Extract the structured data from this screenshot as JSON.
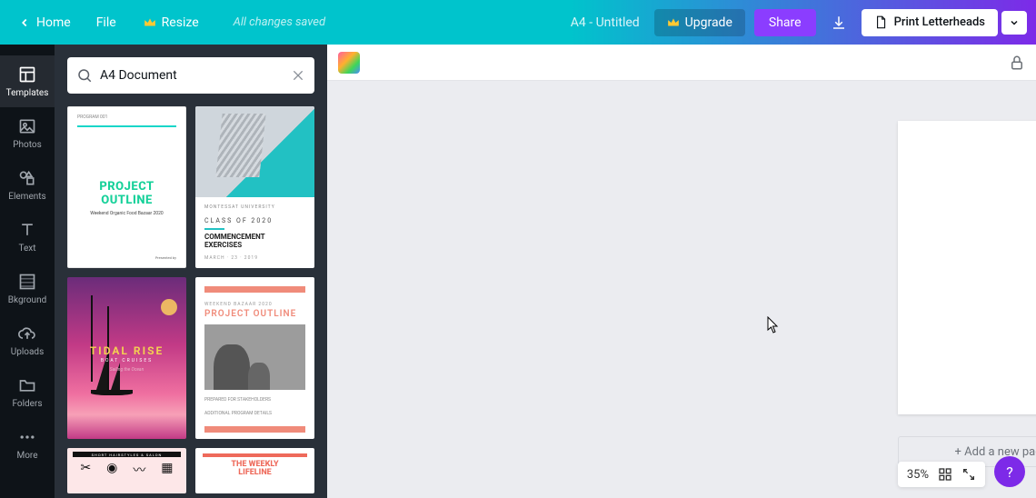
{
  "topbar": {
    "home": "Home",
    "file": "File",
    "resize": "Resize",
    "saved": "All changes saved",
    "doc_title": "A4 - Untitled",
    "upgrade": "Upgrade",
    "share": "Share",
    "print": "Print Letterheads"
  },
  "rail": {
    "templates": "Templates",
    "photos": "Photos",
    "elements": "Elements",
    "text": "Text",
    "background": "Bkground",
    "uploads": "Uploads",
    "folders": "Folders",
    "more": "More"
  },
  "search": {
    "value": "A4 Document"
  },
  "templates": {
    "t1": {
      "pre": "PROGRAM 001",
      "title_a": "PROJECT",
      "title_b": "OUTLINE",
      "sub": "Weekend Organic Food Bazaar 2020",
      "footer": "Presented by"
    },
    "t2": {
      "univ": "MONTESSAT UNIVERSITY",
      "class": "CLASS OF 2020",
      "comm_a": "COMMENCEMENT",
      "comm_b": "EXERCISES",
      "date": "MARCH · 23 · 2019"
    },
    "t3": {
      "title": "TIDAL RISE",
      "sub": "BOAT CRUISES",
      "tiny": "Sailing the Ocean"
    },
    "t4": {
      "tiny": "WEEKEND BAZAAR 2020",
      "title": "PROJECT OUTLINE",
      "foot_a": "PREPARED FOR STAKEHOLDERS",
      "foot_b": "ADDITIONAL PROGRAM DETAILS"
    },
    "t5": {
      "strip": "SHORT HAIRSTYLES & SALON"
    },
    "t6": {
      "title_a": "THE WEEKLY",
      "title_b": "LIFELINE"
    }
  },
  "canvas": {
    "add_page": "+ Add a new page",
    "zoom": "35%"
  },
  "help": "?"
}
